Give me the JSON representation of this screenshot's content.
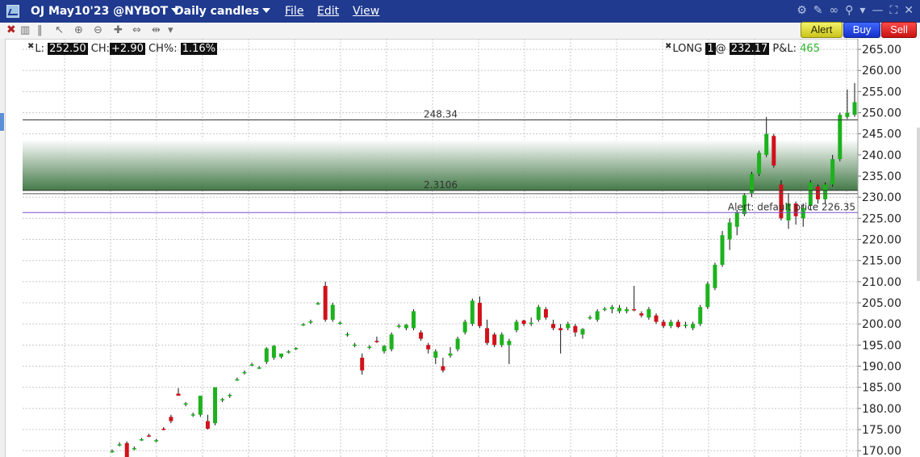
{
  "window": {
    "symbol": "OJ May10'23 @NYBOT",
    "timeframe": "Daily candles",
    "menus": [
      "File",
      "Edit",
      "View"
    ]
  },
  "toolbar": {
    "alert_label": "Alert",
    "buy_label": "Buy",
    "sell_label": "Sell"
  },
  "info": {
    "last_label": "L:",
    "last_value": "252.50",
    "change_label": "CH:",
    "change_value": "+2.90",
    "change_pct_label": "CH%:",
    "change_pct_value": "1.16%",
    "position_label": "LONG",
    "position_qty": "1",
    "position_at": "@",
    "position_price": "232.17",
    "pnl_label": "P&L:",
    "pnl_value": "465"
  },
  "colors": {
    "up": "#1db21d",
    "down": "#d0121b",
    "zone": "#2f6b34",
    "alert_line": "#7a4fd1",
    "grid": "#c8c8c8"
  },
  "chart_data": {
    "type": "candlestick",
    "ylim": [
      168.5,
      267.5
    ],
    "yticks": [
      "265.00",
      "260.00",
      "255.00",
      "250.00",
      "245.00",
      "240.00",
      "235.00",
      "230.00",
      "225.00",
      "220.00",
      "215.00",
      "210.00",
      "205.00",
      "200.00",
      "195.00",
      "190.00",
      "185.00",
      "180.00",
      "175.00",
      "170.00"
    ],
    "annotations": {
      "fib_top": {
        "value": 248.3,
        "label": "248.34"
      },
      "fib_bottom": {
        "value": 231.6,
        "label": "2.3106"
      },
      "alert": {
        "value": 226.35,
        "label": "Alert: default price 226.35"
      }
    },
    "candles": [
      {
        "o": 169.8,
        "h": 170.3,
        "l": 169.5,
        "c": 169.9
      },
      {
        "o": 171.4,
        "h": 172.0,
        "l": 171.0,
        "c": 171.5
      },
      {
        "o": 171.8,
        "h": 172.2,
        "l": 167.0,
        "c": 168.0
      },
      {
        "o": 170.5,
        "h": 171.0,
        "l": 170.1,
        "c": 170.6
      },
      {
        "o": 172.6,
        "h": 173.0,
        "l": 172.3,
        "c": 172.7
      },
      {
        "o": 173.6,
        "h": 174.0,
        "l": 173.2,
        "c": 173.5
      },
      {
        "o": 172.4,
        "h": 172.8,
        "l": 172.0,
        "c": 172.5
      },
      {
        "o": 175.2,
        "h": 175.6,
        "l": 174.8,
        "c": 175.1
      },
      {
        "o": 178.0,
        "h": 178.5,
        "l": 176.5,
        "c": 177.0
      },
      {
        "o": 183.5,
        "h": 184.8,
        "l": 183.0,
        "c": 183.0
      },
      {
        "o": 181.0,
        "h": 181.5,
        "l": 180.5,
        "c": 181.2
      },
      {
        "o": 178.5,
        "h": 179.0,
        "l": 178.0,
        "c": 178.6
      },
      {
        "o": 178.5,
        "h": 183.0,
        "l": 178.0,
        "c": 183.0
      },
      {
        "o": 177.0,
        "h": 178.5,
        "l": 175.0,
        "c": 175.2
      },
      {
        "o": 176.5,
        "h": 185.0,
        "l": 176.0,
        "c": 185.0
      },
      {
        "o": 182.0,
        "h": 182.5,
        "l": 181.5,
        "c": 182.2
      },
      {
        "o": 183.0,
        "h": 183.5,
        "l": 182.5,
        "c": 183.2
      },
      {
        "o": 186.8,
        "h": 187.3,
        "l": 186.5,
        "c": 186.9
      },
      {
        "o": 188.5,
        "h": 189.0,
        "l": 188.0,
        "c": 188.6
      },
      {
        "o": 190.3,
        "h": 190.8,
        "l": 190.0,
        "c": 190.4
      },
      {
        "o": 189.6,
        "h": 190.0,
        "l": 189.3,
        "c": 189.7
      },
      {
        "o": 191.0,
        "h": 194.5,
        "l": 190.5,
        "c": 194.2
      },
      {
        "o": 192.0,
        "h": 195.0,
        "l": 191.5,
        "c": 194.8
      },
      {
        "o": 192.2,
        "h": 192.8,
        "l": 191.8,
        "c": 193.0
      },
      {
        "o": 193.4,
        "h": 193.8,
        "l": 193.0,
        "c": 193.5
      },
      {
        "o": 194.1,
        "h": 194.5,
        "l": 193.8,
        "c": 194.3
      },
      {
        "o": 199.8,
        "h": 200.2,
        "l": 199.5,
        "c": 199.9
      },
      {
        "o": 200.5,
        "h": 201.0,
        "l": 200.0,
        "c": 200.6
      },
      {
        "o": 204.8,
        "h": 205.2,
        "l": 204.5,
        "c": 204.9
      },
      {
        "o": 209.0,
        "h": 210.0,
        "l": 200.5,
        "c": 201.0
      },
      {
        "o": 201.0,
        "h": 205.0,
        "l": 200.5,
        "c": 204.5
      },
      {
        "o": 200.2,
        "h": 200.6,
        "l": 199.8,
        "c": 200.3
      },
      {
        "o": 197.5,
        "h": 198.0,
        "l": 197.0,
        "c": 197.6
      },
      {
        "o": 195.0,
        "h": 195.5,
        "l": 194.5,
        "c": 195.1
      },
      {
        "o": 192.0,
        "h": 193.0,
        "l": 188.0,
        "c": 189.0
      },
      {
        "o": 194.5,
        "h": 195.0,
        "l": 194.0,
        "c": 194.6
      },
      {
        "o": 196.0,
        "h": 197.0,
        "l": 195.5,
        "c": 195.7
      },
      {
        "o": 193.5,
        "h": 195.0,
        "l": 193.0,
        "c": 194.8
      },
      {
        "o": 194.0,
        "h": 198.0,
        "l": 193.5,
        "c": 197.5
      },
      {
        "o": 199.5,
        "h": 200.0,
        "l": 199.0,
        "c": 199.6
      },
      {
        "o": 199.0,
        "h": 200.0,
        "l": 198.5,
        "c": 199.8
      },
      {
        "o": 199.0,
        "h": 203.5,
        "l": 198.5,
        "c": 203.0
      },
      {
        "o": 198.0,
        "h": 198.5,
        "l": 196.0,
        "c": 196.5
      },
      {
        "o": 195.0,
        "h": 195.5,
        "l": 193.0,
        "c": 194.0
      },
      {
        "o": 192.0,
        "h": 194.0,
        "l": 190.5,
        "c": 193.5
      },
      {
        "o": 190.0,
        "h": 192.0,
        "l": 188.5,
        "c": 189.0
      },
      {
        "o": 192.5,
        "h": 194.5,
        "l": 192.0,
        "c": 193.0
      },
      {
        "o": 194.0,
        "h": 197.0,
        "l": 193.5,
        "c": 196.5
      },
      {
        "o": 198.0,
        "h": 201.0,
        "l": 197.5,
        "c": 200.5
      },
      {
        "o": 200.0,
        "h": 206.0,
        "l": 199.5,
        "c": 205.5
      },
      {
        "o": 205.0,
        "h": 206.5,
        "l": 199.0,
        "c": 199.5
      },
      {
        "o": 199.0,
        "h": 201.0,
        "l": 195.0,
        "c": 195.5
      },
      {
        "o": 197.5,
        "h": 198.0,
        "l": 194.5,
        "c": 195.0
      },
      {
        "o": 195.0,
        "h": 198.0,
        "l": 194.5,
        "c": 197.5
      },
      {
        "o": 195.0,
        "h": 196.5,
        "l": 190.5,
        "c": 196.0
      },
      {
        "o": 198.5,
        "h": 201.0,
        "l": 198.0,
        "c": 200.5
      },
      {
        "o": 200.8,
        "h": 201.0,
        "l": 199.5,
        "c": 200.0
      },
      {
        "o": 200.0,
        "h": 201.5,
        "l": 199.5,
        "c": 200.3
      },
      {
        "o": 201.0,
        "h": 204.5,
        "l": 200.5,
        "c": 204.0
      },
      {
        "o": 203.5,
        "h": 204.0,
        "l": 201.0,
        "c": 201.5
      },
      {
        "o": 200.0,
        "h": 201.0,
        "l": 198.5,
        "c": 199.0
      },
      {
        "o": 199.0,
        "h": 200.0,
        "l": 193.0,
        "c": 198.5
      },
      {
        "o": 199.0,
        "h": 200.5,
        "l": 198.5,
        "c": 200.0
      },
      {
        "o": 199.5,
        "h": 200.0,
        "l": 197.0,
        "c": 198.0
      },
      {
        "o": 197.5,
        "h": 199.0,
        "l": 196.5,
        "c": 198.8
      },
      {
        "o": 201.5,
        "h": 202.0,
        "l": 201.0,
        "c": 201.6
      },
      {
        "o": 201.0,
        "h": 203.5,
        "l": 200.5,
        "c": 203.0
      },
      {
        "o": 203.5,
        "h": 204.0,
        "l": 203.0,
        "c": 203.6
      },
      {
        "o": 203.5,
        "h": 204.5,
        "l": 202.5,
        "c": 204.0
      },
      {
        "o": 203.0,
        "h": 204.5,
        "l": 202.5,
        "c": 203.8
      },
      {
        "o": 203.0,
        "h": 204.0,
        "l": 202.5,
        "c": 203.5
      },
      {
        "o": 203.5,
        "h": 209.0,
        "l": 203.0,
        "c": 203.2
      },
      {
        "o": 202.5,
        "h": 203.0,
        "l": 201.5,
        "c": 202.0
      },
      {
        "o": 201.5,
        "h": 204.0,
        "l": 201.0,
        "c": 203.5
      },
      {
        "o": 202.0,
        "h": 202.5,
        "l": 200.0,
        "c": 200.5
      },
      {
        "o": 200.5,
        "h": 201.0,
        "l": 199.0,
        "c": 199.5
      },
      {
        "o": 199.5,
        "h": 201.0,
        "l": 199.0,
        "c": 200.5
      },
      {
        "o": 200.5,
        "h": 201.0,
        "l": 199.0,
        "c": 199.3
      },
      {
        "o": 199.5,
        "h": 200.5,
        "l": 199.0,
        "c": 199.8
      },
      {
        "o": 199.0,
        "h": 200.5,
        "l": 198.5,
        "c": 200.0
      },
      {
        "o": 200.0,
        "h": 204.5,
        "l": 199.5,
        "c": 204.0
      },
      {
        "o": 204.0,
        "h": 210.0,
        "l": 203.5,
        "c": 209.5
      },
      {
        "o": 208.5,
        "h": 214.5,
        "l": 208.0,
        "c": 214.0
      },
      {
        "o": 214.0,
        "h": 222.0,
        "l": 213.5,
        "c": 221.0
      },
      {
        "o": 220.0,
        "h": 225.0,
        "l": 217.5,
        "c": 224.0
      },
      {
        "o": 223.0,
        "h": 227.0,
        "l": 221.0,
        "c": 226.5
      },
      {
        "o": 226.0,
        "h": 231.0,
        "l": 225.5,
        "c": 230.5
      },
      {
        "o": 231.0,
        "h": 236.0,
        "l": 230.0,
        "c": 235.5
      },
      {
        "o": 235.5,
        "h": 241.0,
        "l": 235.0,
        "c": 240.5
      },
      {
        "o": 240.0,
        "h": 249.0,
        "l": 239.5,
        "c": 245.0
      },
      {
        "o": 244.5,
        "h": 245.0,
        "l": 237.0,
        "c": 237.5
      },
      {
        "o": 233.0,
        "h": 234.0,
        "l": 224.5,
        "c": 225.0
      },
      {
        "o": 224.5,
        "h": 231.0,
        "l": 222.5,
        "c": 228.5
      },
      {
        "o": 228.5,
        "h": 229.0,
        "l": 223.5,
        "c": 225.5
      },
      {
        "o": 225.0,
        "h": 228.5,
        "l": 223.0,
        "c": 227.5
      },
      {
        "o": 228.0,
        "h": 234.0,
        "l": 227.0,
        "c": 233.5
      },
      {
        "o": 232.5,
        "h": 233.0,
        "l": 228.5,
        "c": 229.5
      },
      {
        "o": 229.5,
        "h": 233.5,
        "l": 228.5,
        "c": 233.0
      },
      {
        "o": 233.0,
        "h": 240.0,
        "l": 232.5,
        "c": 239.0
      },
      {
        "o": 239.0,
        "h": 250.0,
        "l": 238.5,
        "c": 249.5
      },
      {
        "o": 249.0,
        "h": 255.5,
        "l": 248.5,
        "c": 250.0
      },
      {
        "o": 249.5,
        "h": 257.0,
        "l": 249.0,
        "c": 252.5
      }
    ]
  }
}
